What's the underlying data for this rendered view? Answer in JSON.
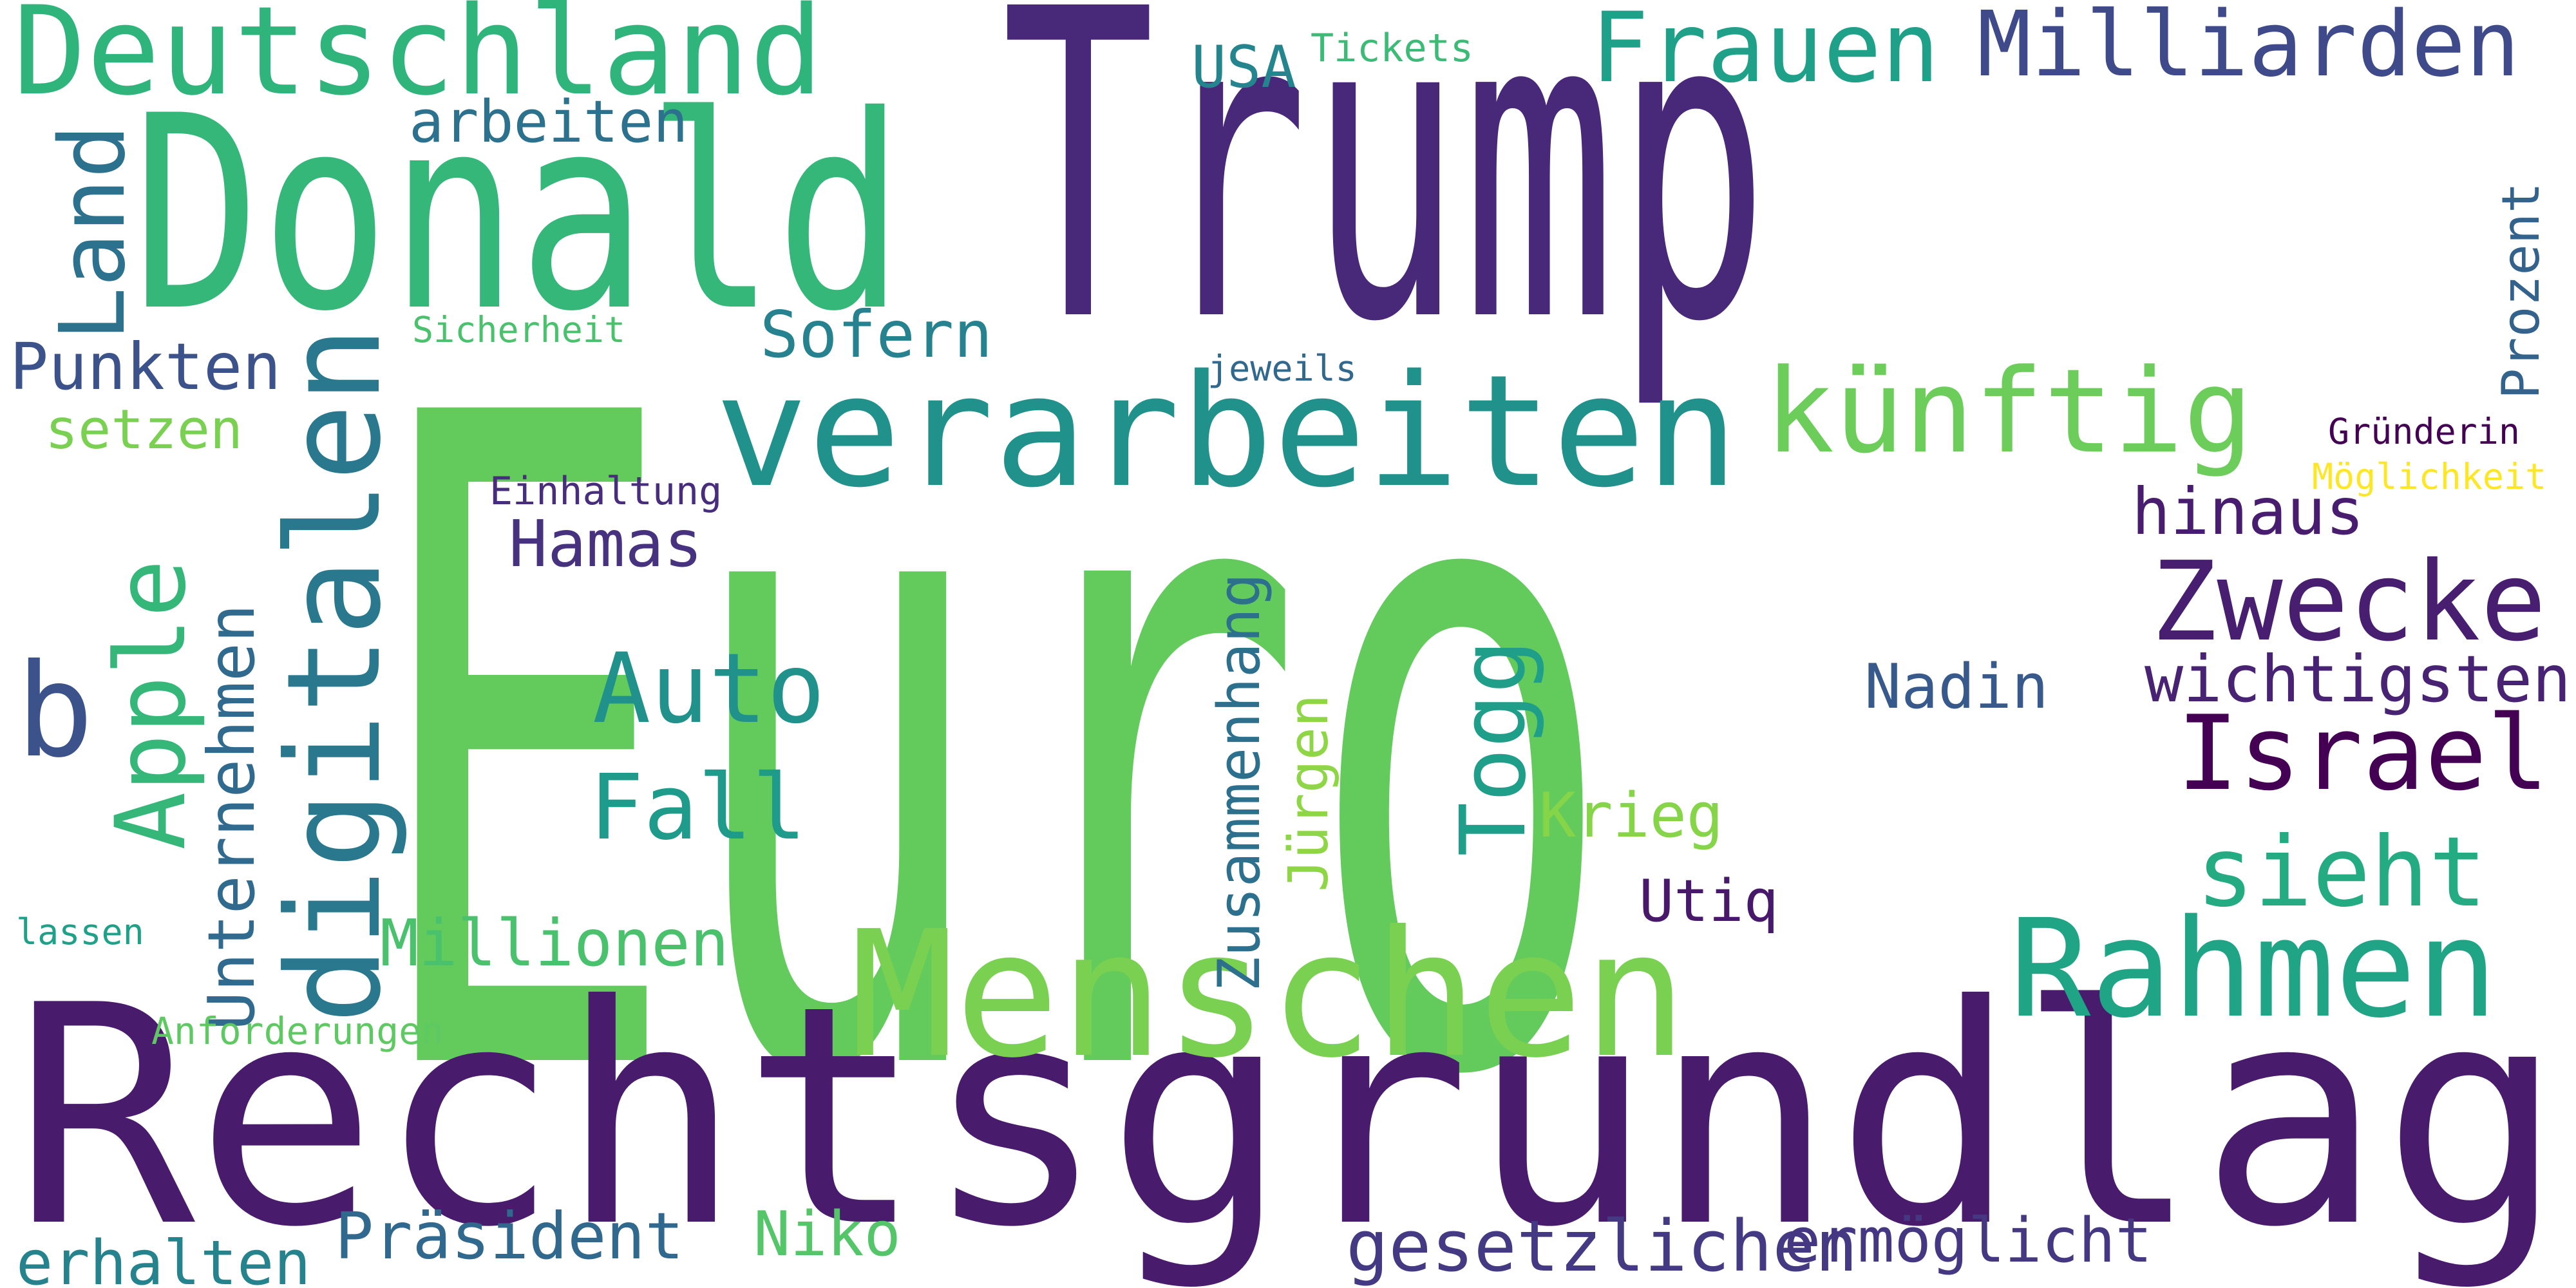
{
  "words": [
    {
      "text": "Trump",
      "color": "#482878"
    },
    {
      "text": "Euro",
      "color": "#62CB5C"
    },
    {
      "text": "Rechtsgrundlage",
      "color": "#481B6D"
    },
    {
      "text": "Donald",
      "color": "#35B779"
    },
    {
      "text": "verarbeiten",
      "color": "#21918C"
    },
    {
      "text": "Menschen",
      "color": "#7AD151"
    },
    {
      "text": "Deutschland",
      "color": "#2FB47C"
    },
    {
      "text": "Milliarden",
      "color": "#3E4A89"
    },
    {
      "text": "Frauen",
      "color": "#1FA088"
    },
    {
      "text": "künftig",
      "color": "#6CCD5A"
    },
    {
      "text": "Rahmen",
      "color": "#20A486"
    },
    {
      "text": "digitalen",
      "color": "#2A788E"
    },
    {
      "text": "Zwecke",
      "color": "#481F70"
    },
    {
      "text": "Land",
      "color": "#2C728E"
    },
    {
      "text": "Israel",
      "color": "#440154"
    },
    {
      "text": "Apple",
      "color": "#35B779"
    },
    {
      "text": "b",
      "color": "#3B528B"
    },
    {
      "text": "Auto",
      "color": "#21918C"
    },
    {
      "text": "Fall",
      "color": "#1E9B8A"
    },
    {
      "text": "sieht",
      "color": "#25AB82"
    },
    {
      "text": "Togg",
      "color": "#1F9E89"
    },
    {
      "text": "Präsident",
      "color": "#31688E"
    },
    {
      "text": "gesetzlichen",
      "color": "#443A83"
    },
    {
      "text": "ermöglicht",
      "color": "#453781"
    },
    {
      "text": "erhalten",
      "color": "#25838E"
    },
    {
      "text": "Sofern",
      "color": "#26828E"
    },
    {
      "text": "Punkten",
      "color": "#3B528B"
    },
    {
      "text": "Hamas",
      "color": "#46327E"
    },
    {
      "text": "hinaus",
      "color": "#481D6F"
    },
    {
      "text": "wichtigsten",
      "color": "#482374"
    },
    {
      "text": "Millionen",
      "color": "#4AC16D"
    },
    {
      "text": "Zusammenhang",
      "color": "#2D708E"
    },
    {
      "text": "Unternehmen",
      "color": "#306A8E"
    },
    {
      "text": "Prozent",
      "color": "#33638D"
    },
    {
      "text": "arbeiten",
      "color": "#2C728E"
    },
    {
      "text": "Nadin",
      "color": "#38598C"
    },
    {
      "text": "Krieg",
      "color": "#86D549"
    },
    {
      "text": "Niko",
      "color": "#54C568"
    },
    {
      "text": "Jürgen",
      "color": "#8ED645"
    },
    {
      "text": "USA",
      "color": "#25858E"
    },
    {
      "text": "Utiq",
      "color": "#48186A"
    },
    {
      "text": "setzen",
      "color": "#7AD151"
    },
    {
      "text": "Tickets",
      "color": "#3BBB75"
    },
    {
      "text": "Sicherheit",
      "color": "#4AC16D"
    },
    {
      "text": "Einhaltung",
      "color": "#472D7B"
    },
    {
      "text": "jeweils",
      "color": "#31688E"
    },
    {
      "text": "Gründerin",
      "color": "#440154"
    },
    {
      "text": "Möglichkeit",
      "color": "#FDE725"
    },
    {
      "text": "lassen",
      "color": "#1FA088"
    },
    {
      "text": "Anforderungen",
      "color": "#5EC962"
    }
  ]
}
